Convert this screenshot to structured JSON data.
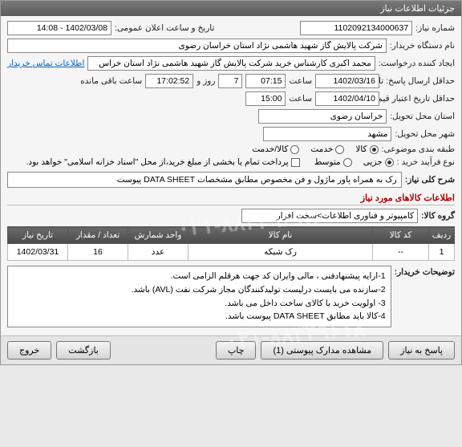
{
  "panel_title": "جزئیات اطلاعات نیاز",
  "need_no_label": "شماره نیاز:",
  "need_no": "1102092134000637",
  "pub_date_label": "تاریخ و ساعت اعلان عمومی:",
  "pub_date": "1402/03/08 - 14:08",
  "buyer_label": "نام دستگاه خریدار:",
  "buyer": "شرکت پالایش گاز شهید هاشمی نژاد   استان خراسان رضوی",
  "creator_label": "ایجاد کننده درخواست:",
  "creator": "محمد اکبری کارشناس خرید شرکت پالایش گاز شهید هاشمی نژاد   استان خراس",
  "contact_link": "اطلاعات تماس خریدار",
  "deadline_label": "حداقل ارسال پاسخ: تا تاریخ:",
  "deadline_date": "1402/03/16",
  "time_label": "ساعت",
  "deadline_time": "07:15",
  "remain_days": "7",
  "day_and_label": "روز و",
  "remain_time": "17:02:52",
  "remain_suffix": "ساعت باقی مانده",
  "validity_label": "حداقل تاریخ اعتبار قیمت: تا تاریخ:",
  "validity_date": "1402/04/10",
  "validity_time": "15:00",
  "province_label": "استان محل تحویل:",
  "province": "خراسان رضوی",
  "city_label": "شهر محل تحویل:",
  "city": "مشهد",
  "category_label": "طبقه بندی موضوعی:",
  "cat_goods": "کالا",
  "cat_service": "خدمت",
  "cat_both": "کالا/خدمت",
  "process_label": "نوع فرآیند خرید :",
  "proc_partial": "جزیی",
  "proc_medium": "متوسط",
  "payment_note": "پرداخت تمام یا بخشی از مبلغ خرید،از محل \"اسناد خزانه اسلامی\" خواهد بود.",
  "desc_label": "شرح کلی نیاز:",
  "description": "رک به همراه پاور ماژول و فن مخصوص مطابق مشخصات DATA SHEET پیوست",
  "items_title": "اطلاعات کالاهای مورد نیاز",
  "group_label": "گروه کالا:",
  "group_value": "کامپیوتر و فناوری اطلاعات>سخت افزار",
  "table": {
    "headers": [
      "ردیف",
      "کد کالا",
      "نام کالا",
      "واحد شمارش",
      "تعداد / مقدار",
      "تاریخ نیاز"
    ],
    "row": [
      "1",
      "--",
      "رک شبکه",
      "عدد",
      "16",
      "1402/03/31"
    ]
  },
  "buyer_notes_label": "توضیحات خریدار:",
  "buyer_notes": [
    "1-ارایه پیشنهادفنی ، مالی وایران کد جهت هرقلم الزامی است.",
    "2-سازنده می بایست درلیست تولیدکنندگان مجاز شرکت نفت (AVL)  باشد.",
    "3- اولویت خرید  با کالای ساخت  داخل می باشد.",
    "4-کالا باید مطابق DATA SHEET پیوست باشد."
  ],
  "buttons": {
    "respond": "پاسخ به نیاز",
    "attachments": "مشاهده مدارک پیوستی (1)",
    "print": "چاپ",
    "back": "بازگشت",
    "exit": "خروج"
  },
  "watermark": "۰۲۱-۸۸۳۴۹۶۱۸"
}
